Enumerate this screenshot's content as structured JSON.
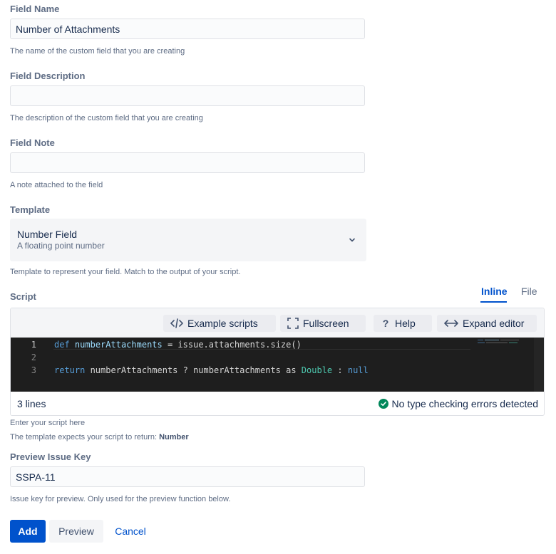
{
  "fields": {
    "name": {
      "label": "Field Name",
      "value": "Number of Attachments",
      "help": "The name of the custom field that you are creating"
    },
    "description": {
      "label": "Field Description",
      "value": "",
      "help": "The description of the custom field that you are creating"
    },
    "note": {
      "label": "Field Note",
      "value": "",
      "help": "A note attached to the field"
    },
    "template": {
      "label": "Template",
      "selected_title": "Number Field",
      "selected_subtitle": "A floating point number",
      "help": "Template to represent your field. Match to the output of your script.",
      "icon": "chevron-down-icon"
    }
  },
  "script": {
    "label": "Script",
    "tabs": {
      "inline": "Inline",
      "file": "File"
    },
    "toolbar": {
      "example": "Example scripts",
      "fullscreen": "Fullscreen",
      "help": "Help",
      "expand": "Expand editor"
    },
    "code": {
      "line_numbers": [
        "1",
        "2",
        "3"
      ],
      "line1": {
        "kw": "def",
        "var": "numberAttachments",
        "rest": " = issue.attachments.size()"
      },
      "line3": {
        "kw": "return",
        "mid": " numberAttachments ? numberAttachments as ",
        "type": "Double",
        "sep": " : ",
        "null": "null"
      }
    },
    "status": {
      "lines": "3 lines",
      "check": "No type checking errors detected",
      "check_color": "#00875a"
    },
    "help_enter": "Enter your script here",
    "help_returns_prefix": "The template expects your script to return: ",
    "help_returns_type": "Number"
  },
  "preview_key": {
    "label": "Preview Issue Key",
    "value": "SSPA-11",
    "help": "Issue key for preview. Only used for the preview function below."
  },
  "actions": {
    "add": "Add",
    "preview": "Preview",
    "cancel": "Cancel"
  },
  "colors": {
    "primary": "#0052cc",
    "editor_bg": "#1e1e1e"
  }
}
